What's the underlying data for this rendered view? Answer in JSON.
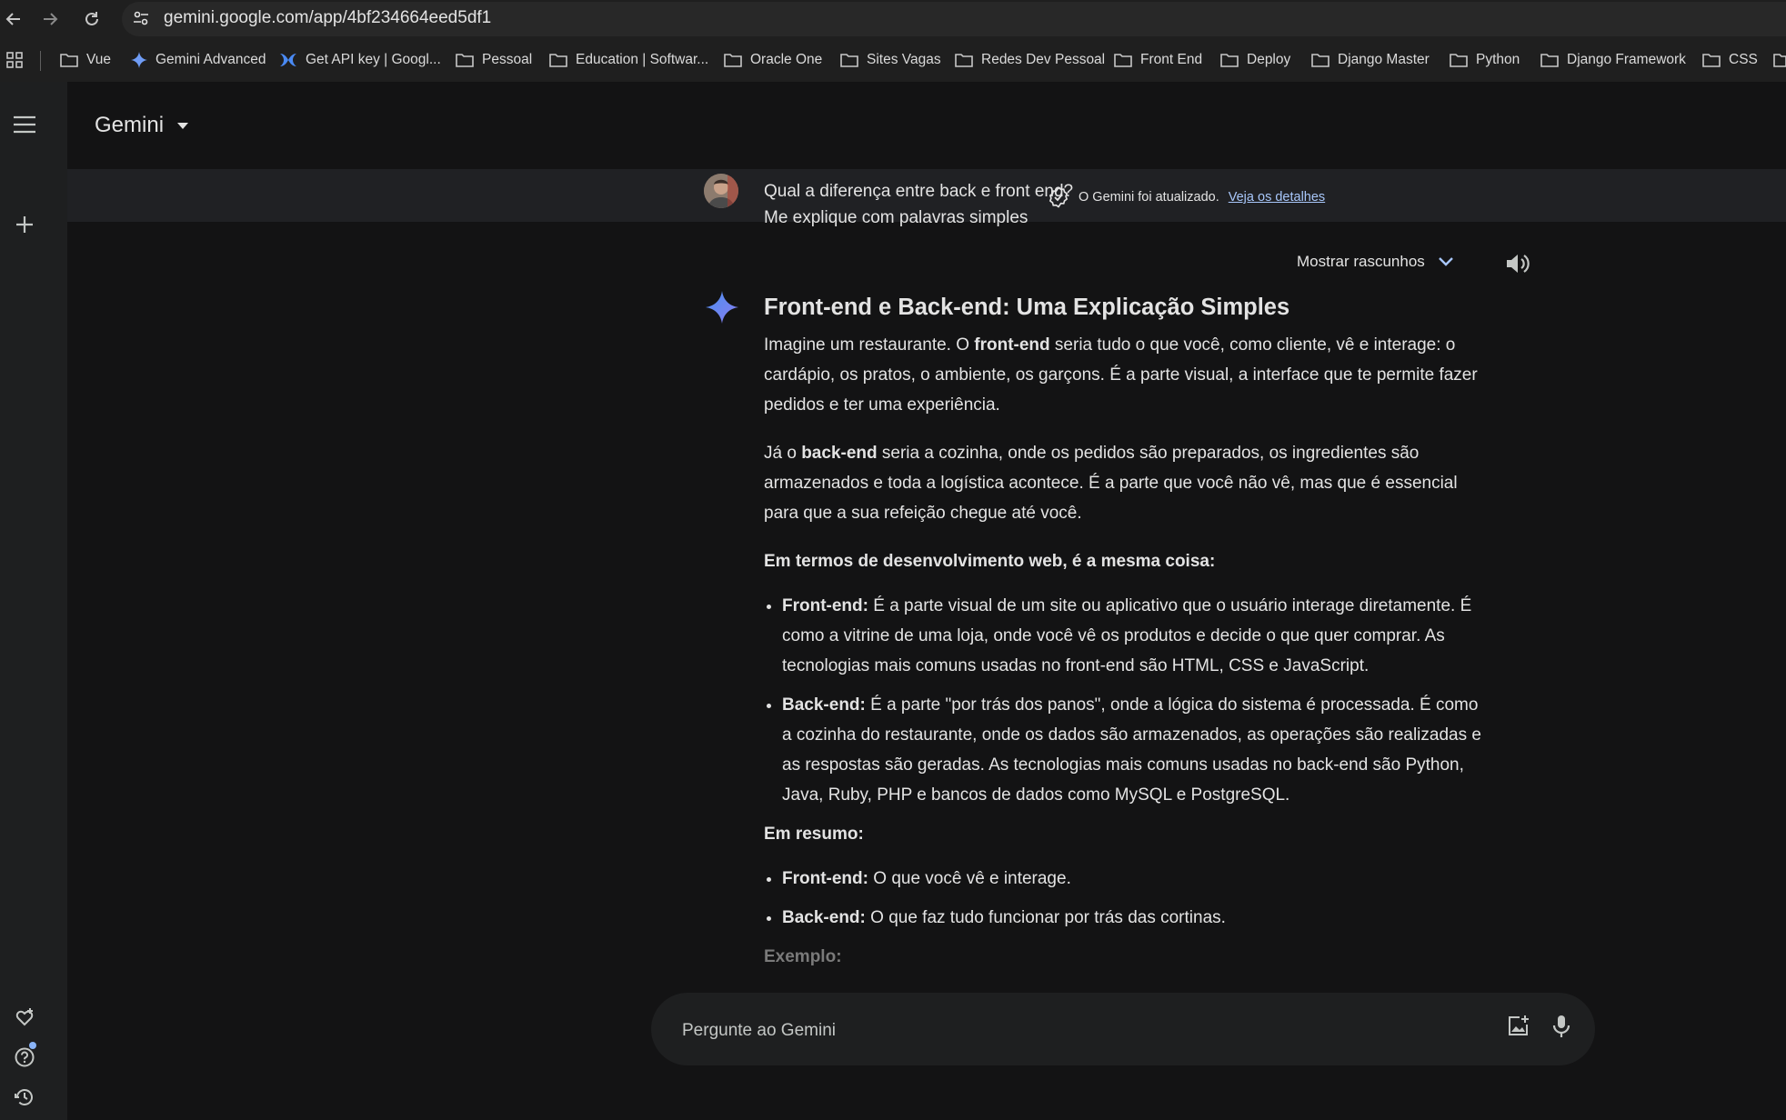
{
  "browser": {
    "url": "gemini.google.com/app/4bf234664eed5df1",
    "bookmarks": [
      {
        "label": "Vue",
        "icon": "folder-icon"
      },
      {
        "label": "Gemini Advanced",
        "icon": "gemini-sparkle-icon"
      },
      {
        "label": "Get API key | Googl...",
        "icon": "ai-studio-icon"
      },
      {
        "label": "Pessoal",
        "icon": "folder-icon"
      },
      {
        "label": "Education | Softwar...",
        "icon": "folder-icon"
      },
      {
        "label": "Oracle One",
        "icon": "folder-icon"
      },
      {
        "label": "Sites Vagas",
        "icon": "folder-icon"
      },
      {
        "label": "Redes Dev Pessoal",
        "icon": "folder-icon"
      },
      {
        "label": "Front End",
        "icon": "folder-icon"
      },
      {
        "label": "Deploy",
        "icon": "folder-icon"
      },
      {
        "label": "Django Master",
        "icon": "folder-icon"
      },
      {
        "label": "Python",
        "icon": "folder-icon"
      },
      {
        "label": "Django Framework",
        "icon": "folder-icon"
      },
      {
        "label": "CSS",
        "icon": "folder-icon"
      }
    ]
  },
  "app": {
    "title": "Gemini",
    "banner_text": "O Gemini foi atualizado.",
    "banner_link": "Veja os detalhes"
  },
  "conversation": {
    "prompt_line1": "Qual a diferença entre back e front end?",
    "prompt_line2": "Me explique com palavras simples",
    "drafts_label": "Mostrar rascunhos",
    "response": {
      "heading": "Front-end e Back-end: Uma Explicação Simples",
      "p1_a": "Imagine um restaurante. O ",
      "p1_b": "front-end",
      "p1_c": " seria tudo o que você, como cliente, vê e interage: o cardápio, os pratos, o ambiente, os garçons. É a parte visual, a interface que te permite fazer pedidos e ter uma experiência.",
      "p2_a": "Já o ",
      "p2_b": "back-end",
      "p2_c": " seria a cozinha, onde os pedidos são preparados, os ingredientes são armazenados e toda a logística acontece. É a parte que você não vê, mas que é essencial para que a sua refeição chegue até você.",
      "p3": "Em termos de desenvolvimento web, é a mesma coisa:",
      "list1": [
        {
          "term": "Front-end:",
          "text": " É a parte visual de um site ou aplicativo que o usuário interage diretamente. É como a vitrine de uma loja, onde você vê os produtos e decide o que quer comprar. As tecnologias mais comuns usadas no front-end são HTML, CSS e JavaScript."
        },
        {
          "term": "Back-end:",
          "text": " É a parte \"por trás dos panos\", onde a lógica do sistema é processada. É como a cozinha do restaurante, onde os dados são armazenados, as operações são realizadas e as respostas são geradas. As tecnologias mais comuns usadas no back-end são Python, Java, Ruby, PHP e bancos de dados como MySQL e PostgreSQL."
        }
      ],
      "summary_title": "Em resumo:",
      "list2": [
        {
          "term": "Front-end:",
          "text": " O que você vê e interage."
        },
        {
          "term": "Back-end:",
          "text": " O que faz tudo funcionar por trás das cortinas."
        }
      ],
      "example_title": "Exemplo:"
    }
  },
  "input": {
    "placeholder": "Pergunte ao Gemini"
  }
}
